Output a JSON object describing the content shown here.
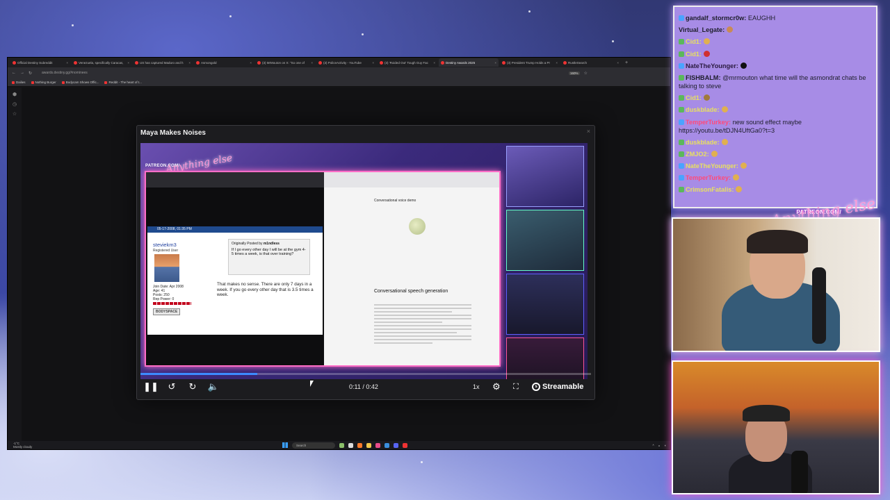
{
  "browser": {
    "tabs": [
      {
        "label": "Official Destiny Subreddit"
      },
      {
        "label": "Venezuela, specifically Caracas,"
      },
      {
        "label": "US has captured Maduro and h"
      },
      {
        "label": "Asmongold"
      },
      {
        "label": "(3) MrMouton on X: \"So one of"
      },
      {
        "label": "(3) PoliceActivity - YouTube"
      },
      {
        "label": "(3) 'Roided Out' Tough Guy Fac"
      },
      {
        "label": "Destiny Awards 2025"
      },
      {
        "label": "(3) President Trump Holds a Pr"
      },
      {
        "label": "RustleSearch"
      }
    ],
    "new_tab": "+",
    "url": "awards.destiny.gg/#nominees",
    "zoom": "160%",
    "bookmarks": [
      "Dailies",
      "Nothing Burger",
      "Bodycam Shows Offic...",
      "Reddit - The heart of t..."
    ]
  },
  "modal": {
    "title": "Maya Makes Noises",
    "close": "×"
  },
  "video": {
    "patreon_tag": "PATREON.COM/",
    "signature": "Anything else",
    "forum": {
      "header": "05-17-2008, 01:35 PM",
      "username": "steviekm3",
      "role": "Registered User",
      "join_date": "Join Date: Apr 2008",
      "age": "Age: 41",
      "posts": "Posts: 250",
      "rep": "Rep Power: 0",
      "donor_badge": "BODYSPACE",
      "quote_label": "Originally Posted by",
      "quote_author": "m1ndless",
      "quote_text": "If I go every other day I will be at the gym 4-5 times a week, is that over training?",
      "reply": "That makes no sense. There are only 7 days in a week. If you go every other day that is 3.5 times a week."
    },
    "doc": {
      "heading1": "Conversational voice demo",
      "heading2": "Conversational speech generation"
    },
    "progress": 0.26,
    "timecode": "0:11 / 0:42",
    "speed": "1x",
    "brand": "Streamable"
  },
  "taskbar": {
    "weather": "-1°C\nMostly cloudy",
    "search": "Search"
  },
  "chat": {
    "messages": [
      {
        "name": "gandalf_stormcr0w:",
        "text": " EAUGHH",
        "color": "#1e1e2c",
        "badge": "#4aa3ff"
      },
      {
        "name": "Virtual_Legate:",
        "text": "",
        "color": "#1e1e2c",
        "badge": "",
        "emote": "#c98a55"
      },
      {
        "name": "Cid1:",
        "text": "",
        "color": "#e8e060",
        "badge": "#5bb85b",
        "emote": "#e0b050"
      },
      {
        "name": "Cid1:",
        "text": "",
        "color": "#e8e060",
        "badge": "#5bb85b",
        "emote": "#d03030"
      },
      {
        "name": "NateTheYounger:",
        "text": "",
        "color": "#2a1a40",
        "badge": "#4aa3ff",
        "emote": "#111"
      },
      {
        "name": "FISHBALM:",
        "text": " @mrmouton what time will the asmondrat chats be talking to steve",
        "color": "#1e1e2c",
        "badge": "#5bb85b"
      },
      {
        "name": "Cid1:",
        "text": "",
        "color": "#e8e060",
        "badge": "#5bb85b",
        "emote": "#a07a3a"
      },
      {
        "name": "duskblade:",
        "text": "",
        "color": "#e8e060",
        "badge": "#5bb85b",
        "emote": "#e0b050"
      },
      {
        "name": "TemperTurkey:",
        "text": " new sound effect maybe https://youtu.be/tDJN4UftGa0?t=3",
        "color": "#ff4a7a",
        "badge": "#4aa3ff"
      },
      {
        "name": "duskblade:",
        "text": "",
        "color": "#e8e060",
        "badge": "#5bb85b",
        "emote": "#e0b050"
      },
      {
        "name": "ZMJO2:",
        "text": "",
        "color": "#e8e060",
        "badge": "#5bb85b",
        "emote": "#e0b050"
      },
      {
        "name": "NateTheYounger:",
        "text": "",
        "color": "#e8e060",
        "badge": "#4aa3ff",
        "emote": "#e0b050"
      },
      {
        "name": "TemperTurkey:",
        "text": "",
        "color": "#ff4a7a",
        "badge": "#4aa3ff",
        "emote": "#e0b050"
      },
      {
        "name": "CrimsonFatalis:",
        "text": "",
        "color": "#e8e060",
        "badge": "#5bb85b",
        "emote": "#e0b050"
      }
    ]
  },
  "cam": {
    "patreon_tag": "PATREON.COM/",
    "signature": "Anything else"
  }
}
